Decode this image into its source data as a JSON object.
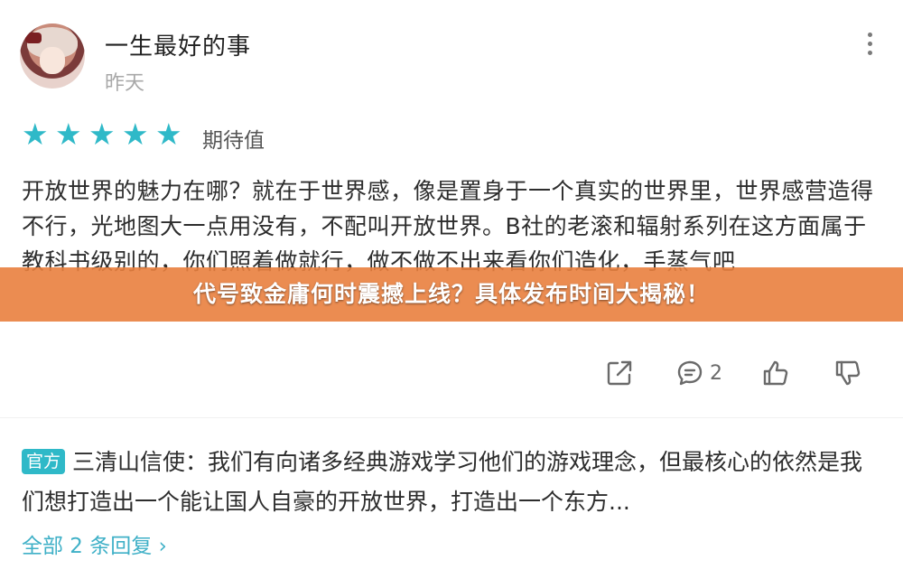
{
  "post": {
    "username": "一生最好的事",
    "date": "昨天",
    "rating_label": "期待值",
    "stars": 5,
    "comment": "开放世界的魅力在哪？就在于世界感，像是置身于一个真实的世界里，世界感营造得不行，光地图大一点用没有，不配叫开放世界。B社的老滚和辐射系列在这方面属于教科书级别的，你们照着做就行，做不做不出来看你们造化，手蒸气吧",
    "comment_count": "2"
  },
  "banner": {
    "title": "代号致金庸何时震撼上线？具体发布时间大揭秘！"
  },
  "reply": {
    "tag": "官方",
    "author": "三清山信使",
    "text": "：我们有向诸多经典游戏学习他们的游戏理念，但最核心的依然是我们想打造出一个能让国人自豪的开放世界，打造出一个东方...",
    "all_replies": "全部 2 条回复"
  },
  "colors": {
    "accent": "#2fb9c8",
    "banner": "#e9803e",
    "link": "#3fb0c7"
  },
  "icons": [
    "more-icon",
    "star-icon",
    "share-icon",
    "comment-icon",
    "thumbs-up-icon",
    "thumbs-down-icon"
  ]
}
